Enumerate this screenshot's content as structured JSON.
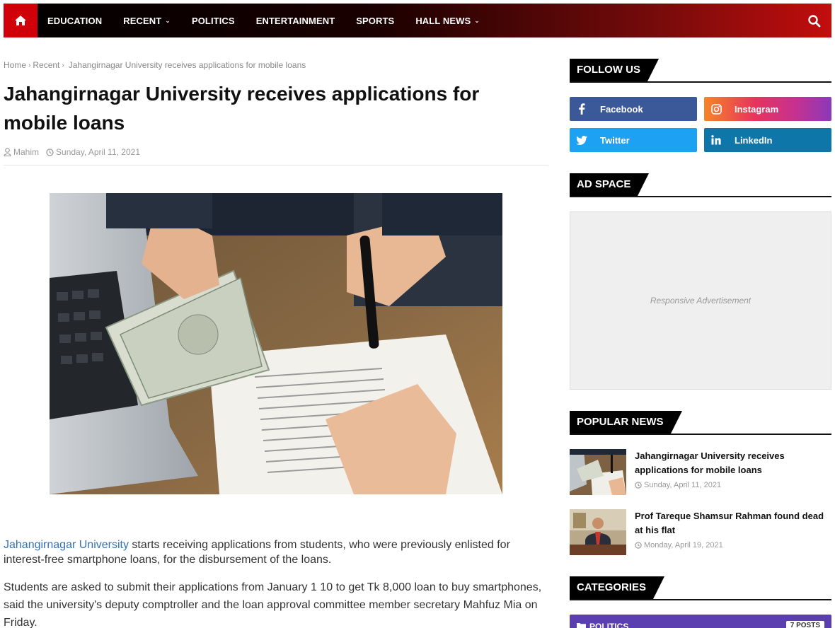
{
  "nav": {
    "items": [
      {
        "label": "EDUCATION",
        "has_dropdown": false
      },
      {
        "label": "RECENT",
        "has_dropdown": true
      },
      {
        "label": "POLITICS",
        "has_dropdown": false
      },
      {
        "label": "ENTERTAINMENT",
        "has_dropdown": false
      },
      {
        "label": "SPORTS",
        "has_dropdown": false
      },
      {
        "label": "HALL NEWS",
        "has_dropdown": true
      }
    ],
    "home_icon": "home-icon",
    "search_icon": "search-icon",
    "accent_color": "#d0000b"
  },
  "breadcrumb": {
    "home": "Home",
    "recent": "Recent",
    "current": "Jahangirnagar University receives applications for mobile loans"
  },
  "article": {
    "title": "Jahangirnagar University receives applications for mobile loans",
    "author": "Mahim",
    "date": "Sunday, April 11, 2021",
    "link_text": "Jahangirnagar University",
    "p1_rest": " starts receiving applications from students, who were previously enlisted for interest-free smartphone loans, for the disbursement of the loans.",
    "p2": "Students are asked to submit their applications from January 1 10 to get Tk 8,000 loan to buy smartphones, said the university's deputy comptroller and the loan approval committee member secretary Mahfuz Mia on Friday."
  },
  "sidebar": {
    "follow_title": "FOLLOW US",
    "social": [
      {
        "label": "Facebook",
        "icon": "facebook-icon",
        "color": "#3b5998"
      },
      {
        "label": "Instagram",
        "icon": "instagram-icon",
        "color": "#e8335c"
      },
      {
        "label": "Twitter",
        "icon": "twitter-icon",
        "color": "#1da1f2"
      },
      {
        "label": "LinkedIn",
        "icon": "linkedin-icon",
        "color": "#0e76a8"
      }
    ],
    "ad_title": "AD SPACE",
    "ad_text": "Responsive Advertisement",
    "popular_title": "POPULAR NEWS",
    "popular": [
      {
        "title": "Jahangirnagar University receives applications for mobile loans",
        "date": "Sunday, April 11, 2021"
      },
      {
        "title": "Prof Tareque Shamsur Rahman found dead at his flat",
        "date": "Monday, April 19, 2021"
      }
    ],
    "categories_title": "CATEGORIES",
    "categories": [
      {
        "name": "POLITICS",
        "count": "7 POSTS",
        "color": "#5b3fb0"
      }
    ]
  }
}
